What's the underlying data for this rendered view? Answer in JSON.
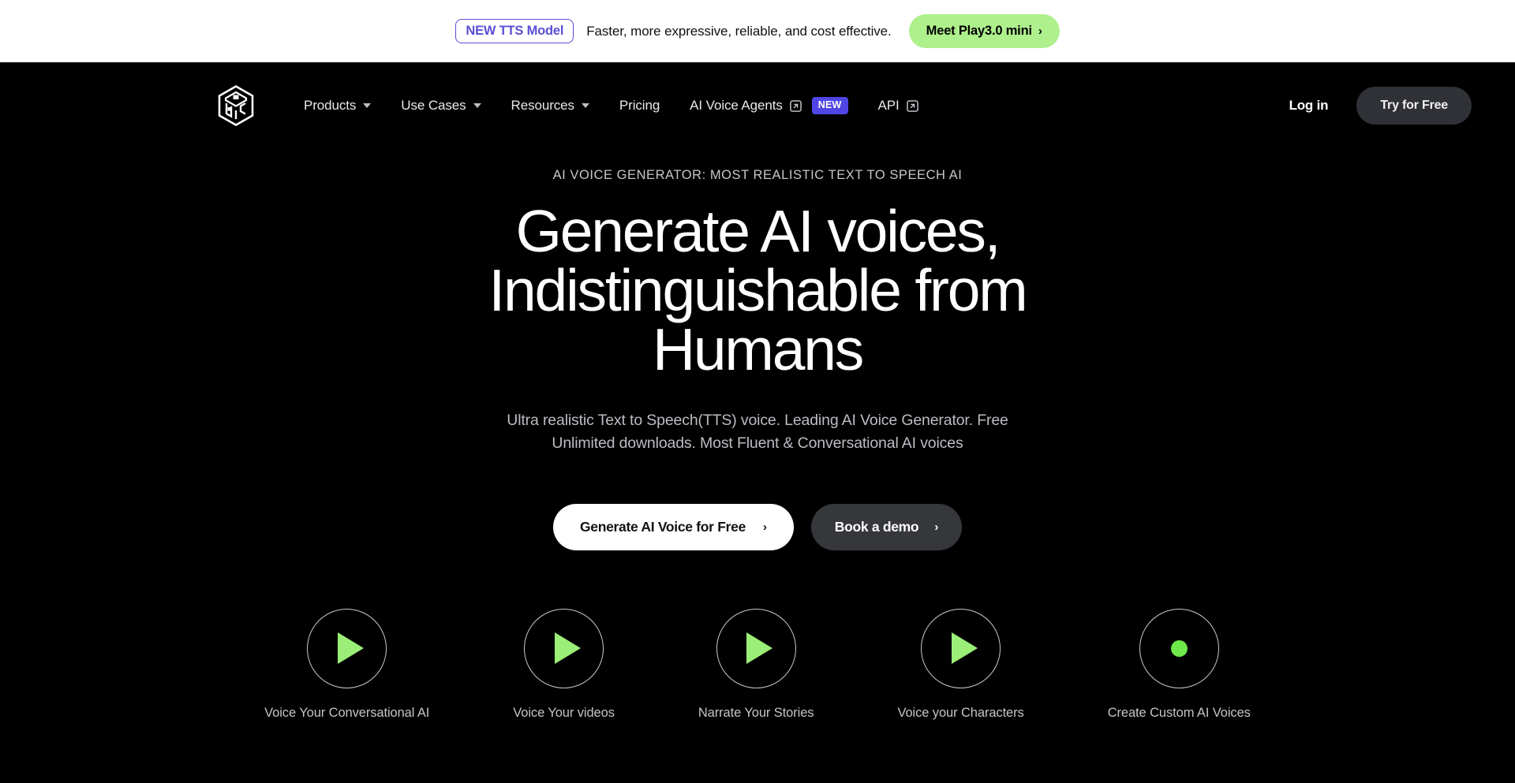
{
  "banner": {
    "badge": "NEW TTS Model",
    "message": "Faster, more expressive, reliable, and cost effective.",
    "cta_label": "Meet Play3.0 mini",
    "cta_chevron": "›",
    "badge_color": "#5b4fd6",
    "cta_bg": "#aef08c"
  },
  "nav": {
    "logo_name": "play-ai-cube-logo",
    "items": [
      {
        "label": "Products",
        "has_caret": true,
        "has_external": false,
        "badge": null
      },
      {
        "label": "Use Cases",
        "has_caret": true,
        "has_external": false,
        "badge": null
      },
      {
        "label": "Resources",
        "has_caret": true,
        "has_external": false,
        "badge": null
      },
      {
        "label": "Pricing",
        "has_caret": false,
        "has_external": false,
        "badge": null
      },
      {
        "label": "AI Voice Agents",
        "has_caret": false,
        "has_external": true,
        "badge": "NEW"
      },
      {
        "label": "API",
        "has_caret": false,
        "has_external": true,
        "badge": null
      }
    ],
    "login_label": "Log in",
    "try_label": "Try for Free",
    "new_badge_color": "#4f46e5"
  },
  "hero": {
    "eyebrow": "AI VOICE GENERATOR: MOST REALISTIC TEXT TO SPEECH AI",
    "headline": "Generate AI voices, Indistinguishable from Humans",
    "subtitle": "Ultra realistic Text to Speech(TTS) voice. Leading AI Voice Generator. Free Unlimited downloads. Most Fluent & Conversational AI voices",
    "primary_cta": "Generate AI Voice for Free",
    "primary_chevron": "›",
    "secondary_cta": "Book a demo",
    "secondary_chevron": "›"
  },
  "usecases": [
    {
      "label": "Voice Your Conversational AI",
      "icon": "play-icon"
    },
    {
      "label": "Voice Your videos",
      "icon": "play-icon"
    },
    {
      "label": "Narrate Your Stories",
      "icon": "play-icon"
    },
    {
      "label": "Voice your Characters",
      "icon": "play-icon"
    },
    {
      "label": "Create Custom AI Voices",
      "icon": "record-dot-icon"
    }
  ],
  "colors": {
    "accent_green": "#9bee78",
    "background": "#000000"
  }
}
